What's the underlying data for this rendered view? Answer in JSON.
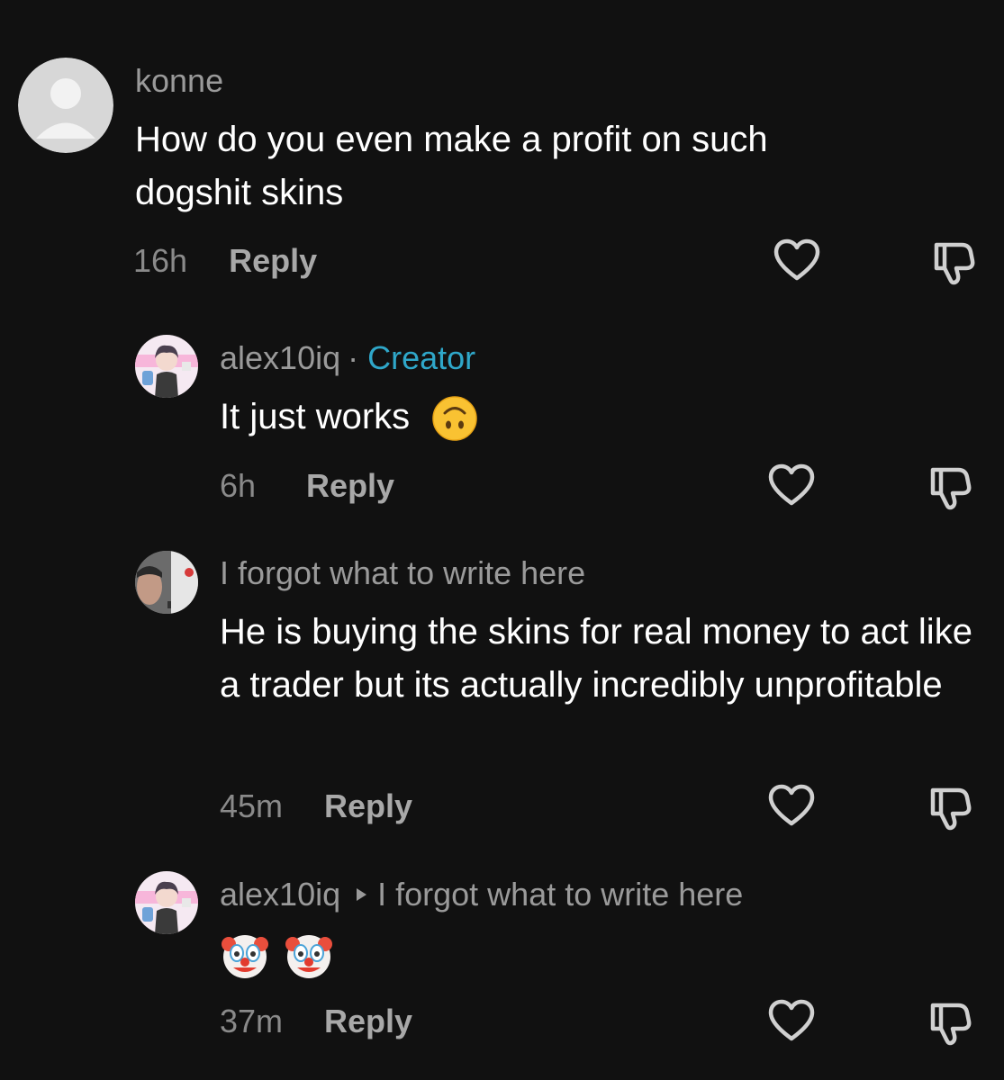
{
  "comments": [
    {
      "username": "konne",
      "text": "How do you even make a profit on such dogshit skins",
      "time": "16h",
      "reply_label": "Reply",
      "avatar": "default-avatar-icon"
    },
    {
      "username": "alex10iq",
      "separator": "·",
      "badge": "Creator",
      "text": "It just works",
      "emoji": "upside-down-face-emoji",
      "time": "6h",
      "reply_label": "Reply",
      "avatar": "anime-character-avatar"
    },
    {
      "username": "I forgot what to write here",
      "text": "He is buying the skins for real money to act like a trader but its actually incredibly unprofitable",
      "time": "45m",
      "reply_label": "Reply",
      "avatar": "photo-avatar"
    },
    {
      "username": "alex10iq",
      "reply_to": "I forgot what to write here",
      "emojis": [
        "clown-face-emoji",
        "clown-face-emoji"
      ],
      "time": "37m",
      "reply_label": "Reply",
      "avatar": "anime-character-avatar"
    }
  ],
  "icons": {
    "like": "heart-outline-icon",
    "dislike": "thumbs-down-outline-icon"
  },
  "colors": {
    "background": "#111111",
    "creator_badge": "#2fa7c9",
    "username": "#9a9a9a"
  }
}
